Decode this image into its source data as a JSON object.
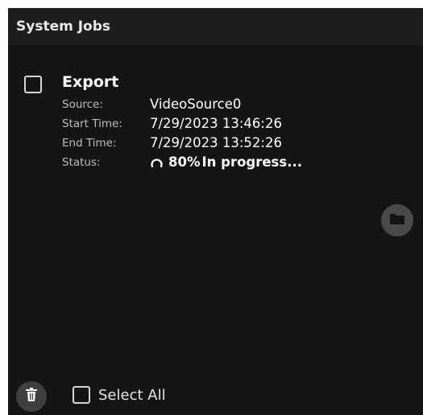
{
  "header": {
    "title": "System Jobs"
  },
  "job": {
    "title": "Export",
    "source_label": "Source:",
    "source_value": "VideoSource0",
    "start_label": "Start Time:",
    "start_value": "7/29/2023 13:46:26",
    "end_label": "End Time:",
    "end_value": "7/29/2023 13:52:26",
    "status_label": "Status:",
    "status_percent": "80%",
    "status_text": "In progress...",
    "checked": false
  },
  "footer": {
    "select_all_label": "Select All"
  },
  "icons": {
    "folder": "folder-icon",
    "trash": "trash-icon",
    "spinner": "spinner-icon"
  },
  "colors": {
    "panel_background": "#151515",
    "header_background": "#1e1e1e",
    "text": "#ffffff",
    "muted_text": "#bdbdbd",
    "button_background": "#4a4a4a"
  }
}
